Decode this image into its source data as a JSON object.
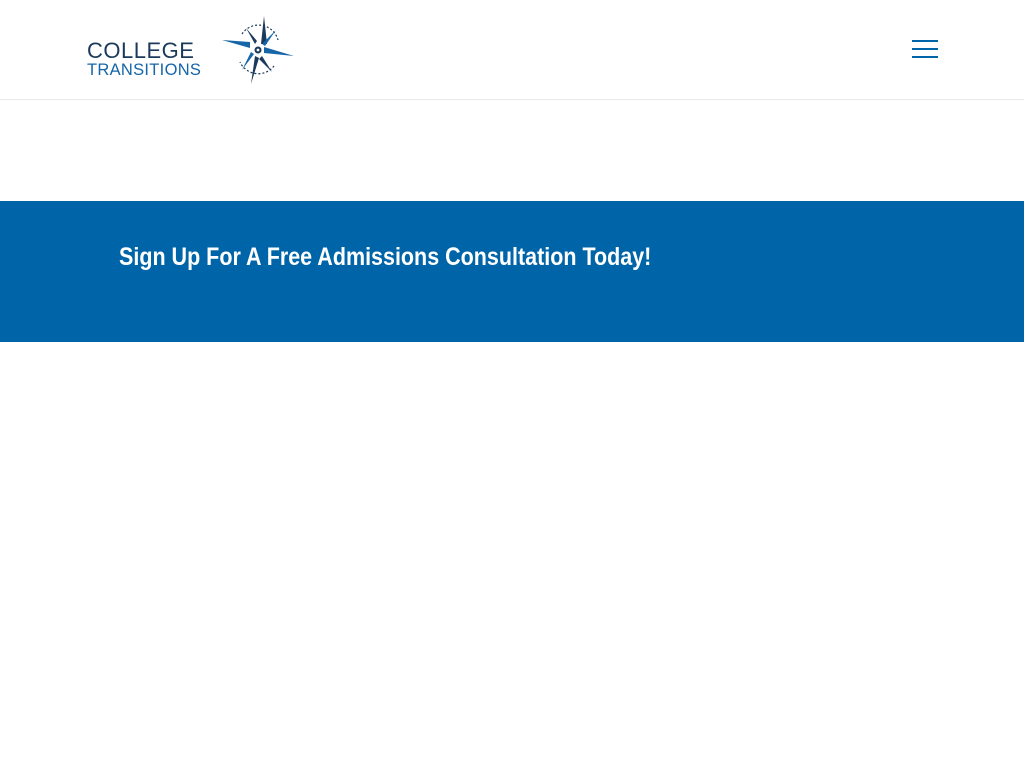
{
  "header": {
    "logo": {
      "line1": "COLLEGE",
      "line2": "TRANSITIONS",
      "icon": "compass-icon",
      "colors": {
        "dark": "#1b3a5b",
        "blue": "#1565a8"
      }
    },
    "menu_icon": "hamburger-menu-icon",
    "menu_color": "#0064a8"
  },
  "banner": {
    "title": "Sign Up For A Free Admissions Consultation Today!",
    "background": "#0064a8",
    "text_color": "#ffffff"
  }
}
